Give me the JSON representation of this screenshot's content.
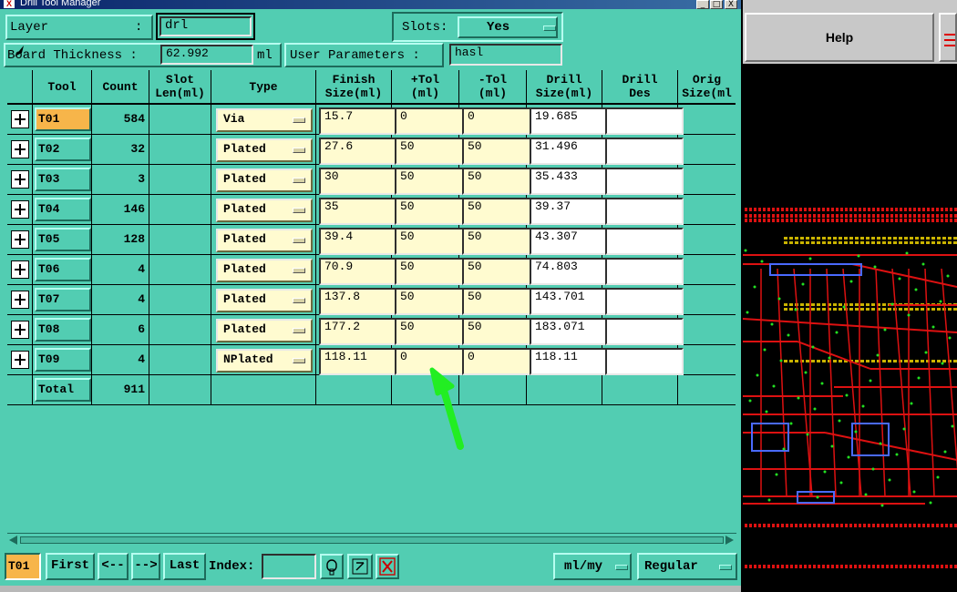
{
  "window": {
    "title": "Drill Tool Manager",
    "app_icon": "x-app-icon",
    "controls": [
      "_",
      "□",
      "X"
    ]
  },
  "header": {
    "layer_label": "Layer",
    "layer_colon": ":",
    "layer_value": "drl",
    "slots_label": "Slots:",
    "slots_value": "Yes",
    "board_thickness_label": "Board Thickness :",
    "board_thickness_value": "62.992",
    "board_thickness_unit": "ml",
    "user_params_label": "User Parameters :",
    "user_params_value": "hasl"
  },
  "table": {
    "columns": [
      "Tool",
      "Count",
      "Slot\nLen(ml)",
      "Type",
      "Finish\nSize(ml)",
      "+Tol\n(ml)",
      "-Tol\n(ml)",
      "Drill\nSize(ml)",
      "Drill\nDes",
      "Orig\nSize(ml"
    ],
    "rows": [
      {
        "tool": "T01",
        "count": "584",
        "type": "Via",
        "finish": "15.7",
        "ptol": "0",
        "mtol": "0",
        "drill": "19.685",
        "des": ""
      },
      {
        "tool": "T02",
        "count": "32",
        "type": "Plated",
        "finish": "27.6",
        "ptol": "50",
        "mtol": "50",
        "drill": "31.496",
        "des": ""
      },
      {
        "tool": "T03",
        "count": "3",
        "type": "Plated",
        "finish": "30",
        "ptol": "50",
        "mtol": "50",
        "drill": "35.433",
        "des": ""
      },
      {
        "tool": "T04",
        "count": "146",
        "type": "Plated",
        "finish": "35",
        "ptol": "50",
        "mtol": "50",
        "drill": "39.37",
        "des": ""
      },
      {
        "tool": "T05",
        "count": "128",
        "type": "Plated",
        "finish": "39.4",
        "ptol": "50",
        "mtol": "50",
        "drill": "43.307",
        "des": ""
      },
      {
        "tool": "T06",
        "count": "4",
        "type": "Plated",
        "finish": "70.9",
        "ptol": "50",
        "mtol": "50",
        "drill": "74.803",
        "des": ""
      },
      {
        "tool": "T07",
        "count": "4",
        "type": "Plated",
        "finish": "137.8",
        "ptol": "50",
        "mtol": "50",
        "drill": "143.701",
        "des": ""
      },
      {
        "tool": "T08",
        "count": "6",
        "type": "Plated",
        "finish": "177.2",
        "ptol": "50",
        "mtol": "50",
        "drill": "183.071",
        "des": ""
      },
      {
        "tool": "T09",
        "count": "4",
        "type": "NPlated",
        "finish": "118.11",
        "ptol": "0",
        "mtol": "0",
        "drill": "118.11",
        "des": ""
      }
    ],
    "total_label": "Total",
    "total_count": "911"
  },
  "bottom": {
    "current_tool": "T01",
    "first": "First",
    "prev": "<--",
    "next": "-->",
    "last": "Last",
    "index_label": "Index:",
    "index_value": "",
    "units": "ml/my",
    "mode": "Regular"
  },
  "right_panel": {
    "help": "Help"
  },
  "colors": {
    "panel": "#52cdb2",
    "field": "#fffbd0",
    "selected_tool": "#f7b54a",
    "annotation_arrow": "#22ee22",
    "trace": "#dd1111"
  }
}
